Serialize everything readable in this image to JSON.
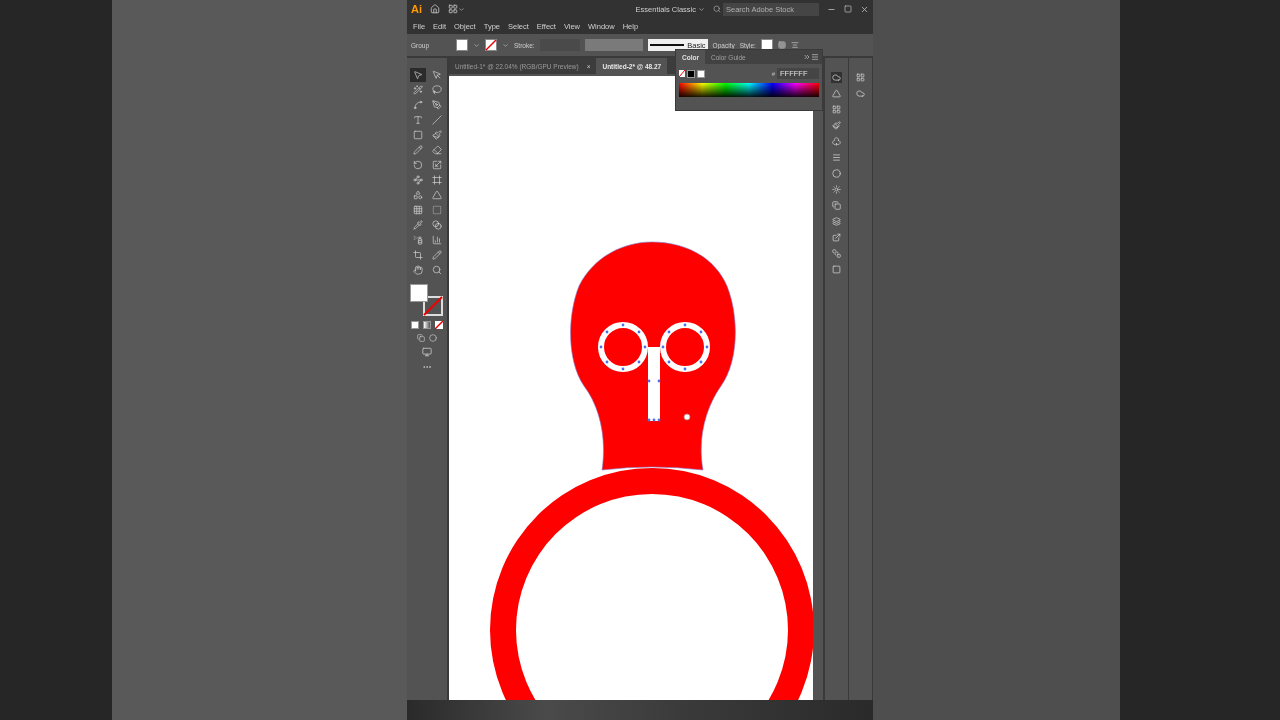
{
  "title_bar": {
    "logo": "Ai",
    "workspace": "Essentials Classic",
    "search": {
      "placeholder": "Search Adobe Stock"
    }
  },
  "menu": [
    "File",
    "Edit",
    "Object",
    "Type",
    "Select",
    "Effect",
    "View",
    "Window",
    "Help"
  ],
  "control_bar": {
    "selection": "Group",
    "stroke_label": "Stroke:",
    "brush": "Basic",
    "opacity_label": "Opacity",
    "style_label": "Style:"
  },
  "tabs": [
    {
      "label": "Untitled-1* @ 22.04% (RGB/GPU Preview)",
      "selected": false,
      "close": "×"
    },
    {
      "label": "Untitled-2* @ 48.27",
      "selected": true
    }
  ],
  "tools": [
    {
      "selected": true
    },
    {
      "selected": false
    },
    {
      "selected": false
    },
    {
      "selected": false
    },
    {
      "selected": false
    },
    {
      "selected": false
    },
    {
      "selected": false
    },
    {
      "selected": false
    },
    {
      "selected": false
    },
    {
      "selected": false
    },
    {
      "selected": false
    },
    {
      "selected": false
    },
    {
      "selected": false
    },
    {
      "selected": false
    },
    {
      "selected": false
    },
    {
      "selected": false
    },
    {
      "selected": false
    },
    {
      "selected": false
    },
    {
      "selected": false
    },
    {
      "selected": false
    },
    {
      "selected": false
    },
    {
      "selected": false
    },
    {
      "selected": false
    },
    {
      "selected": false
    },
    {
      "selected": false
    },
    {
      "selected": false
    },
    {
      "selected": false
    },
    {
      "selected": false
    }
  ],
  "color_panel": {
    "tabs": [
      {
        "label": "Color",
        "selected": true
      },
      {
        "label": "Color Guide",
        "selected": false
      }
    ],
    "hash": "#",
    "hex": "FFFFFF"
  }
}
